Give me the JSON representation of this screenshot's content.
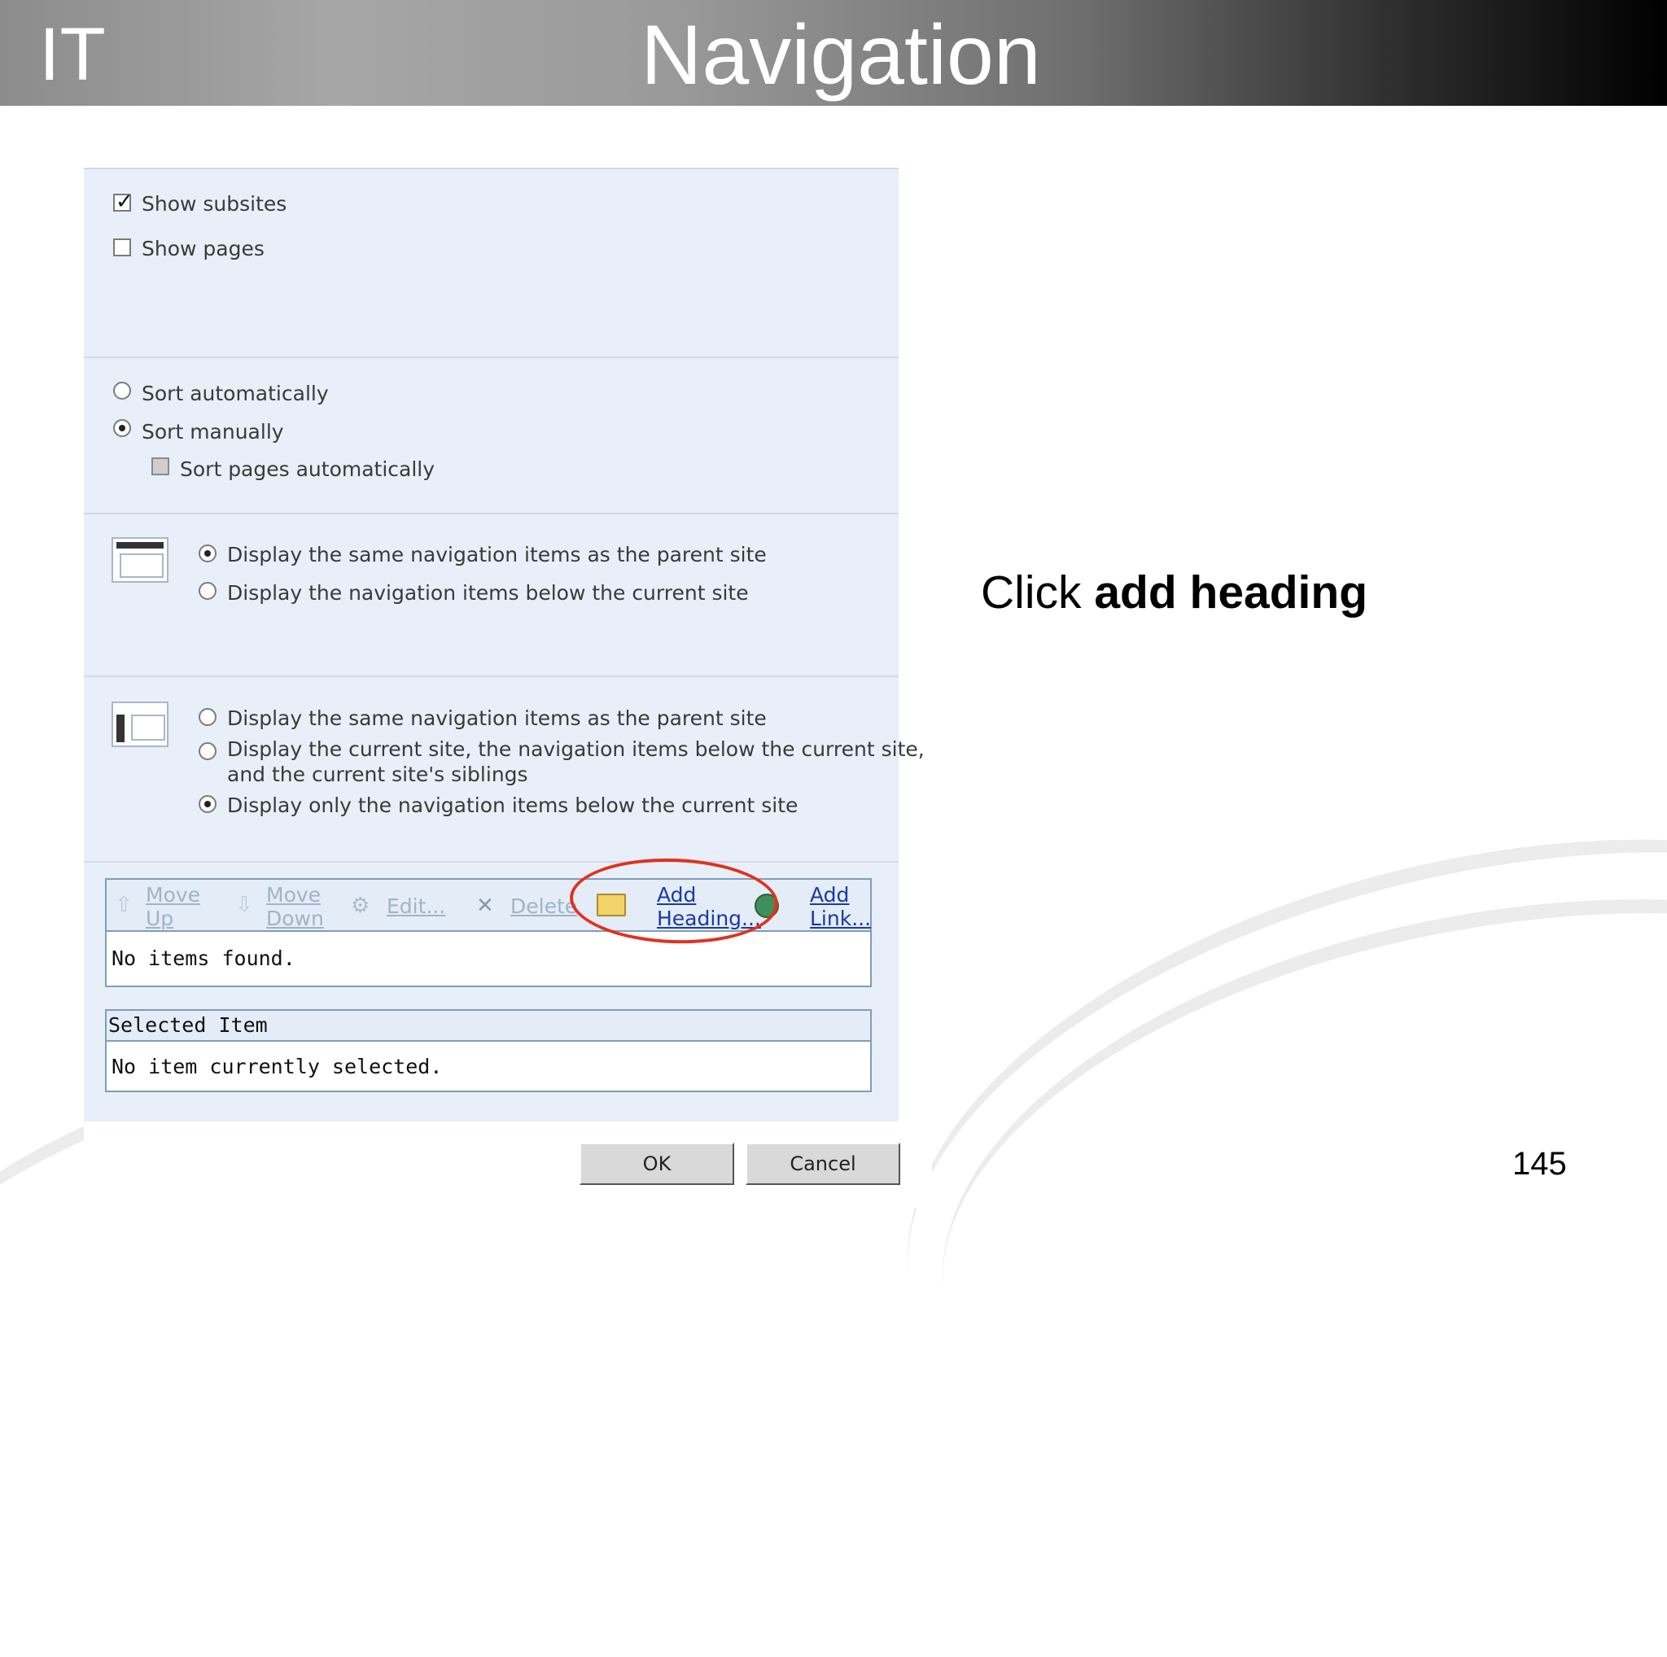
{
  "header": {
    "logo": "IT",
    "title": "Navigation"
  },
  "subsites_pages": {
    "show_subsites": "Show subsites",
    "show_pages": "Show pages"
  },
  "sorting": {
    "sort_auto": "Sort automatically",
    "sort_manual": "Sort manually",
    "sort_pages_auto": "Sort pages automatically"
  },
  "global_nav": {
    "option1": "Display the same navigation items as the parent site",
    "option2": "Display the navigation items below the current site"
  },
  "current_nav": {
    "option1": "Display the same navigation items as the parent site",
    "option2_line1": "Display the current site, the navigation items below the current site,",
    "option2_line2": "and the current site's siblings",
    "option3": "Display only the navigation items below the current site"
  },
  "toolbar": {
    "move_up_1": "Move",
    "move_up_2": "Up",
    "move_down_1": "Move",
    "move_down_2": "Down",
    "edit": "Edit...",
    "delete": "Delete",
    "add_heading_1": "Add",
    "add_heading_2": "Heading...",
    "add_link_1": "Add",
    "add_link_2": "Link..."
  },
  "list": {
    "empty": "No items found."
  },
  "selected": {
    "header": "Selected Item",
    "empty": "No item currently selected."
  },
  "buttons": {
    "ok": "OK",
    "cancel": "Cancel"
  },
  "instruction": {
    "prefix": "Click ",
    "bold": "add heading"
  },
  "page_number": "145",
  "colors": {
    "highlight_ellipse": "#e0321e",
    "link": "#1a3aa6",
    "panel_bg": "#e8eff9"
  }
}
